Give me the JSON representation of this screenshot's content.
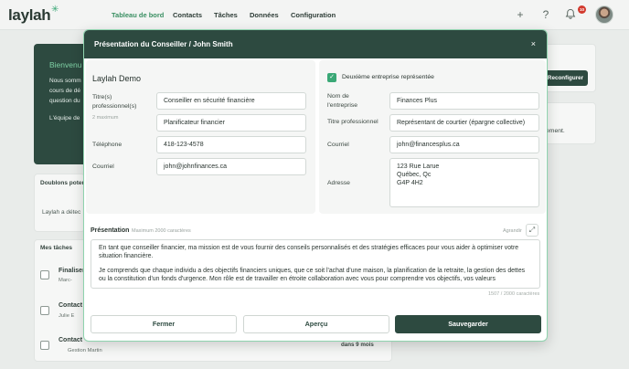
{
  "app": {
    "logo": "laylah"
  },
  "nav": {
    "items": [
      "Tableau de bord",
      "Contacts",
      "Tâches",
      "Données",
      "Configuration"
    ],
    "notifications": "10"
  },
  "background": {
    "welcome_title": "Bienvenu",
    "welcome_lines": [
      "Nous somm",
      "cours de dé",
      "question du",
      "L'équipe de"
    ],
    "duplicates_title": "Doublons poter",
    "duplicates_text": "Laylah a détec",
    "tasks_title": "Mes tâches",
    "tasks": [
      {
        "label": "Finaliser",
        "sub": "Marc-"
      },
      {
        "label": "Contact",
        "sub": "Julie E"
      },
      {
        "label": "Contact",
        "sub": "Gestion Martin"
      }
    ],
    "task_due": "dans 9 mois",
    "reconfigure": "Reconfigurer",
    "right_text": "ement."
  },
  "modal": {
    "title": "Présentation du Conseiller / John Smith",
    "close": "×",
    "left": {
      "section_title": "Laylah Demo",
      "titles_label": "Titre(s) professionnel(s)",
      "titles_hint": "2 maximum",
      "titles": [
        "Conseiller en sécurité financière",
        "Planificateur financier"
      ],
      "phone_label": "Téléphone",
      "phone": "418-123-4578",
      "email_label": "Courriel",
      "email": "john@johnfinances.ca"
    },
    "right": {
      "checkbox_label": "Deuxième entreprise représentée",
      "company_label": "Nom de l'entreprise",
      "company": "Finances Plus",
      "title_label": "Titre professionnel",
      "title": "Représentant de courtier (épargne collective)",
      "email_label": "Courriel",
      "email": "john@financesplus.ca",
      "address_label": "Adresse",
      "address": [
        "123 Rue Larue",
        "Québec, Qc",
        "G4P 4H2"
      ]
    },
    "presentation": {
      "label": "Présentation",
      "hint": "Maximum 2000 caractères",
      "expand": "Agrandir",
      "paragraphs": [
        "En tant que conseiller financier, ma mission est de vous fournir des conseils personnalisés et des stratégies efficaces pour vous aider à optimiser votre situation financière.",
        "Je comprends que chaque individu a des objectifs financiers uniques, que ce soit l'achat d'une maison, la planification de la retraite, la gestion des dettes ou la constitution d'un fonds d'urgence. Mon rôle est de travailler en étroite collaboration avec vous pour comprendre vos objectifs, vos valeurs"
      ],
      "counter": "1507 / 2000 caractères"
    },
    "buttons": {
      "close": "Fermer",
      "preview": "Aperçu",
      "save": "Sauvegarder"
    }
  }
}
